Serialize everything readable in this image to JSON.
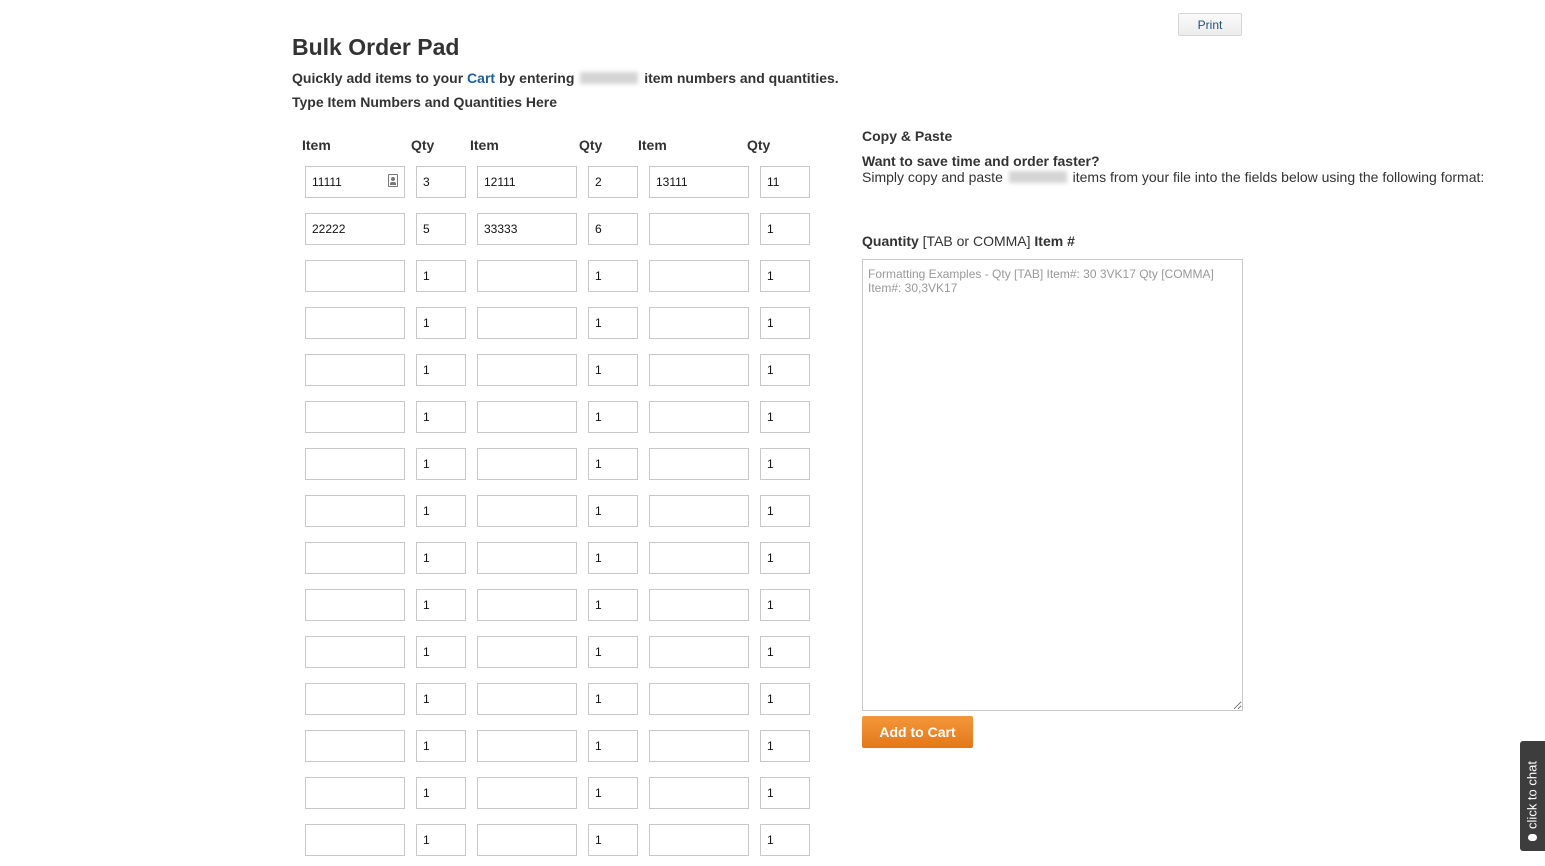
{
  "header": {
    "print_label": "Print",
    "title": "Bulk Order Pad",
    "intro_before": "Quickly add items to your ",
    "cart_link": "Cart",
    "intro_middle": " by entering",
    "intro_after": " item numbers and quantities.",
    "subheading": "Type Item Numbers and Quantities Here"
  },
  "table": {
    "headers": [
      "Item",
      "Qty",
      "Item",
      "Qty",
      "Item",
      "Qty"
    ],
    "rows": [
      [
        "11111",
        "3",
        "12111",
        "2",
        "13111",
        "11"
      ],
      [
        "22222",
        "5",
        "33333",
        "6",
        "",
        "1"
      ],
      [
        "",
        "1",
        "",
        "1",
        "",
        "1"
      ],
      [
        "",
        "1",
        "",
        "1",
        "",
        "1"
      ],
      [
        "",
        "1",
        "",
        "1",
        "",
        "1"
      ],
      [
        "",
        "1",
        "",
        "1",
        "",
        "1"
      ],
      [
        "",
        "1",
        "",
        "1",
        "",
        "1"
      ],
      [
        "",
        "1",
        "",
        "1",
        "",
        "1"
      ],
      [
        "",
        "1",
        "",
        "1",
        "",
        "1"
      ],
      [
        "",
        "1",
        "",
        "1",
        "",
        "1"
      ],
      [
        "",
        "1",
        "",
        "1",
        "",
        "1"
      ],
      [
        "",
        "1",
        "",
        "1",
        "",
        "1"
      ],
      [
        "",
        "1",
        "",
        "1",
        "",
        "1"
      ],
      [
        "",
        "1",
        "",
        "1",
        "",
        "1"
      ],
      [
        "",
        "1",
        "",
        "1",
        "",
        "1"
      ]
    ]
  },
  "copy_paste": {
    "title": "Copy & Paste",
    "question": "Want to save time and order faster?",
    "desc_before": "Simply copy and paste",
    "desc_after": " items from your file into the fields below using the following format:",
    "format_quantity": "Quantity",
    "format_separator": " [TAB or COMMA] ",
    "format_item": "Item #",
    "placeholder": "Formatting Examples - Qty [TAB] Item#: 30 3VK17 Qty [COMMA] Item#: 30,3VK17",
    "add_to_cart": "Add to Cart"
  },
  "chat": {
    "label": "click to chat",
    "icon": "chat-bubble-icon"
  },
  "colors": {
    "accent_orange": "#e8821f",
    "link_blue": "#1d5f99",
    "chat_tab": "#3d3d3d"
  }
}
